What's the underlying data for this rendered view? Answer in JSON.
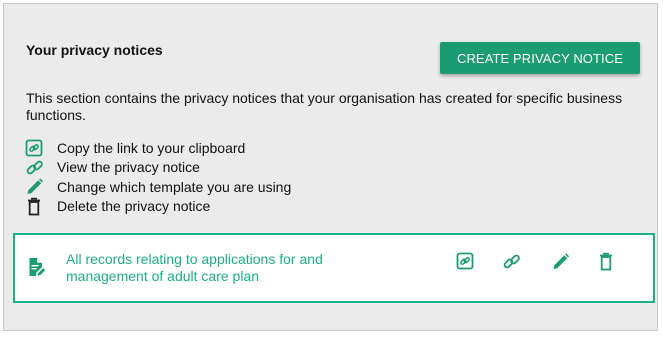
{
  "section": {
    "title": "Your privacy notices",
    "create_button": "CREATE PRIVACY NOTICE",
    "description": "This section contains the privacy notices that your organisation has created for specific business functions."
  },
  "legend": [
    {
      "icon": "copy-link-icon",
      "label": "Copy the link to your clipboard"
    },
    {
      "icon": "link-icon",
      "label": "View the privacy notice"
    },
    {
      "icon": "pencil-icon",
      "label": "Change which template you are using"
    },
    {
      "icon": "trash-icon",
      "label": "Delete the privacy notice"
    }
  ],
  "notices": [
    {
      "icon": "document-edit-icon",
      "title": "All records relating to applications for and management of adult care plan",
      "actions": [
        "copy-link-icon",
        "link-icon",
        "pencil-icon",
        "trash-icon"
      ]
    }
  ],
  "colors": {
    "accent": "#1b9c73",
    "link_text": "#1bae86",
    "panel_bg": "#ebebeb"
  }
}
